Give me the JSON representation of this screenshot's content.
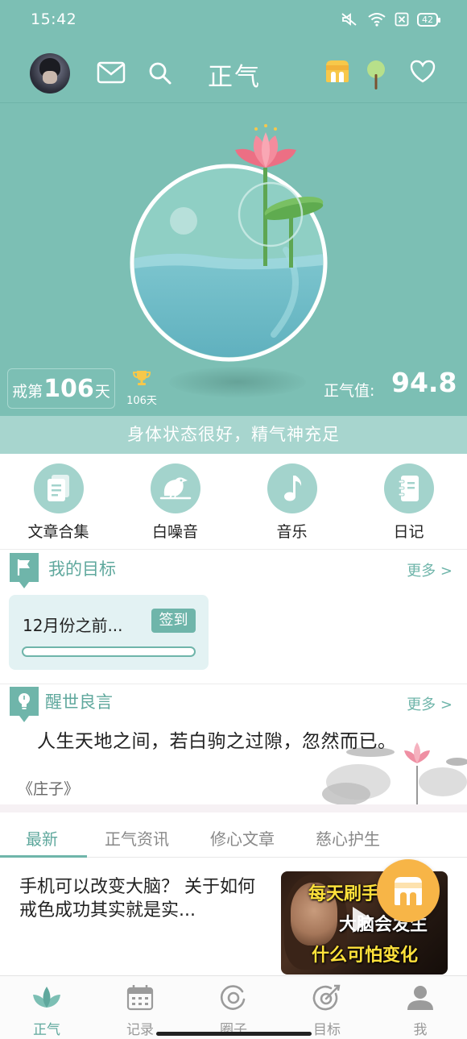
{
  "status_bar": {
    "time": "15:42",
    "battery": "42"
  },
  "header": {
    "title": "正气",
    "icons": [
      "avatar",
      "mail-icon",
      "search-icon",
      "shop-icon",
      "tree-icon",
      "heart-icon"
    ]
  },
  "hero": {
    "streak_prefix": "戒第",
    "streak_days": "106",
    "streak_suffix": "天",
    "trophy_days": "106天",
    "zhengqi_label": "正气值:",
    "zhengqi_value": "94.8",
    "status_message": "身体状态很好，精气神充足"
  },
  "features": [
    {
      "label": "文章合集",
      "icon": "document-icon"
    },
    {
      "label": "白噪音",
      "icon": "bird-icon"
    },
    {
      "label": "音乐",
      "icon": "music-note-icon"
    },
    {
      "label": "日记",
      "icon": "notebook-icon"
    }
  ],
  "goals": {
    "title": "我的目标",
    "more": "更多 >",
    "card": {
      "text": "12月份之前...",
      "checkin": "签到",
      "progress": 0
    }
  },
  "quotes": {
    "title": "醒世良言",
    "more": "更多 >",
    "text": "人生天地之间，若白驹之过隙，忽然而已。",
    "author": "《庄子》"
  },
  "tabs": [
    "最新",
    "正气资讯",
    "修心文章",
    "慈心护生"
  ],
  "active_tab": "最新",
  "article": {
    "title": "手机可以改变大脑？ 关于如何戒色成功其实就是实...",
    "thumb_lines": [
      "每天刷手机",
      "大脑会发生",
      "什么可怕变化"
    ]
  },
  "bottom_nav": [
    {
      "label": "正气",
      "icon": "lotus-icon",
      "active": true
    },
    {
      "label": "记录",
      "icon": "calendar-icon",
      "active": false
    },
    {
      "label": "圈子",
      "icon": "circle-icon",
      "active": false
    },
    {
      "label": "目标",
      "icon": "target-icon",
      "active": false
    },
    {
      "label": "我",
      "icon": "person-icon",
      "active": false
    }
  ],
  "colors": {
    "primary": "#7cbfb4",
    "accent": "#6fb5aa",
    "fab": "#f7b547"
  }
}
